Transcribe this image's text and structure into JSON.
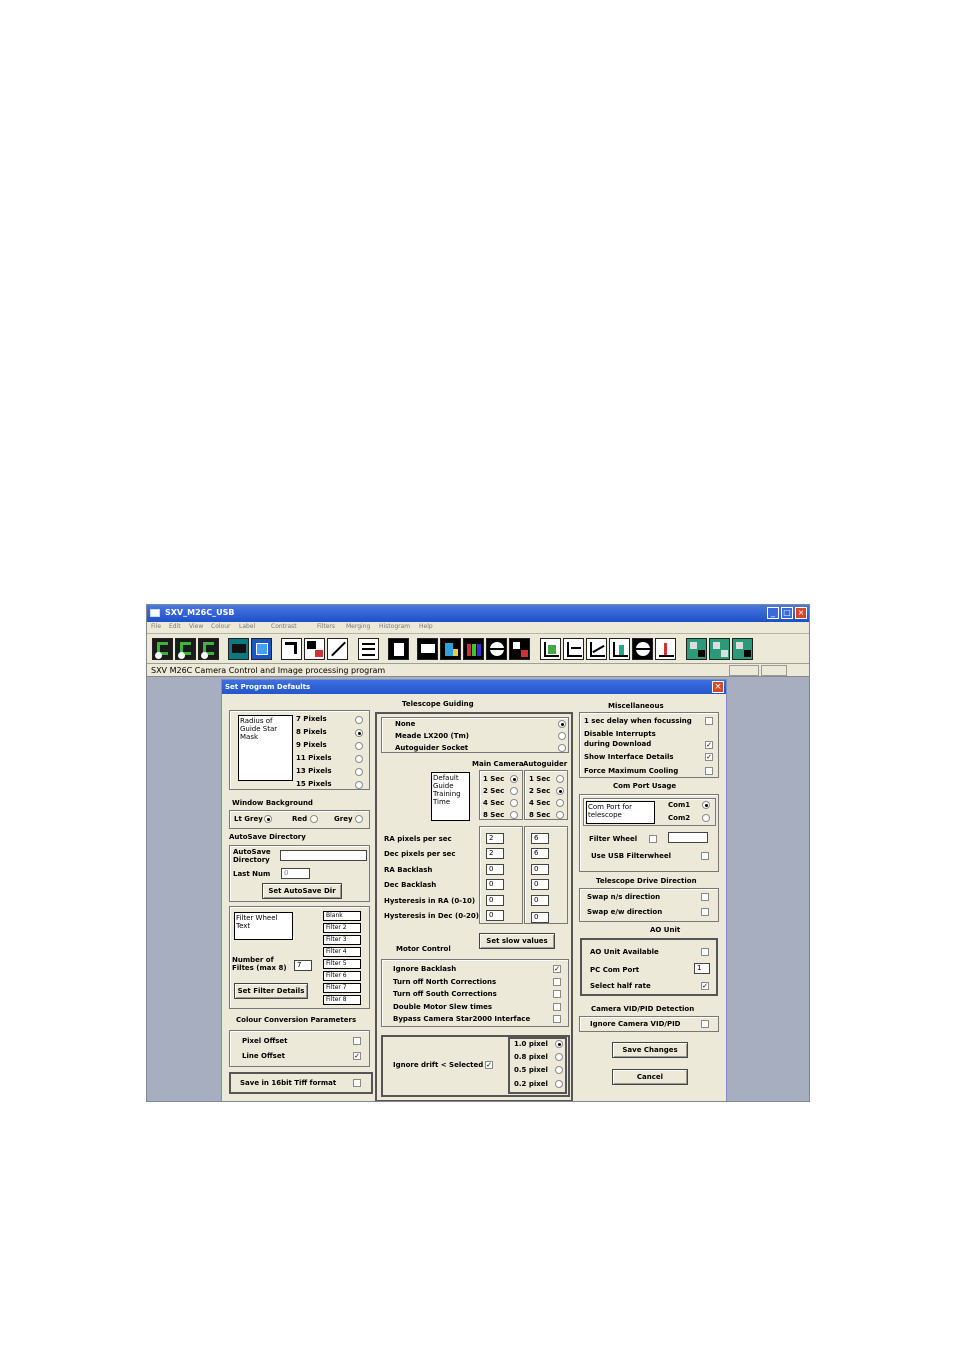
{
  "window": {
    "title": "SXV_M26C_USB",
    "min": "_",
    "max": "□",
    "close": "×"
  },
  "menu": [
    "File",
    "Edit",
    "View",
    "Colour",
    "Label",
    "Contrast",
    "Filters",
    "Merging",
    "Histogram",
    "Help"
  ],
  "status_text": "SXV M26C Camera Control and Image processing program",
  "dialog": {
    "title": "Set Program Defaults",
    "close": "×",
    "guide_mask": {
      "label": "Radius of Guide Star Mask",
      "options": [
        "7 Pixels",
        "8 Pixels",
        "9 Pixels",
        "11 Pixels",
        "13 Pixels",
        "15 Pixels"
      ],
      "selected": "8 Pixels"
    },
    "window_background": {
      "heading": "Window Background",
      "options": [
        "Lt Grey",
        "Red",
        "Grey"
      ],
      "selected": "Lt Grey"
    },
    "autosave": {
      "heading": "AutoSave Directory",
      "dir_label": "AutoSave Directory",
      "dir_value": "",
      "lastnum_label": "Last Num",
      "lastnum_value": "0",
      "button": "Set AutoSave Dir"
    },
    "filter_wheel_text": {
      "label": "Filter Wheel Text",
      "num_label": "Number of Filtes (max 8)",
      "num_value": "7",
      "filters": [
        "Blank",
        "Filter 2",
        "Filter 3",
        "Filter 4",
        "Filter 5",
        "Filter 6",
        "Filter 7",
        "Filter 8"
      ],
      "button": "Set Filter Details"
    },
    "colour_conversion": {
      "heading": "Colour Conversion Parameters",
      "pixel_offset": "Pixel Offset",
      "line_offset": "Line Offset",
      "pixel_checked": false,
      "line_checked": true
    },
    "save16": {
      "label": "Save in 16bit Tiff format",
      "checked": false
    },
    "telescope_guiding": {
      "heading": "Telescope Guiding",
      "options": [
        "None",
        "Meade LX200 (Tm)",
        "Autoguider Socket"
      ],
      "selected": "None",
      "main_camera": "Main Camera",
      "autoguider": "Autoguider",
      "training_label": "Default Guide Training Time",
      "secs": [
        "1 Sec",
        "2 Sec",
        "4 Sec",
        "8 Sec"
      ],
      "main_selected": "1 Sec",
      "auto_selected": "2 Sec",
      "params": [
        {
          "label": "RA pixels per sec",
          "main": "2",
          "auto": "6"
        },
        {
          "label": "Dec pixels per sec",
          "main": "2",
          "auto": "6"
        },
        {
          "label": "RA Backlash",
          "main": "0",
          "auto": "0"
        },
        {
          "label": "Dec Backlash",
          "main": "0",
          "auto": "0"
        },
        {
          "label": "Hysteresis in RA (0-10)",
          "main": "0",
          "auto": "0"
        },
        {
          "label": "Hysteresis in Dec (0-20)",
          "main": "0",
          "auto": "0"
        }
      ],
      "slow_button": "Set slow values"
    },
    "motor_control": {
      "heading": "Motor Control",
      "items": [
        {
          "label": "Ignore Backlash",
          "checked": true
        },
        {
          "label": "Turn off North Corrections",
          "checked": false
        },
        {
          "label": "Turn off South Corrections",
          "checked": false
        },
        {
          "label": "Double Motor Slew times",
          "checked": false
        },
        {
          "label": "Bypass Camera Star2000 Interface",
          "checked": false
        }
      ]
    },
    "drift": {
      "label": "Ignore drift < Selected",
      "checked": true,
      "options": [
        "1.0 pixel",
        "0.8 pixel",
        "0.5 pixel",
        "0.2 pixel"
      ],
      "selected": "1.0 pixel"
    },
    "misc": {
      "heading": "Miscellaneous",
      "items": [
        {
          "label": "1 sec delay when focussing",
          "checked": false
        },
        {
          "label": "Disable Interrupts during Download",
          "checked": true
        },
        {
          "label": "Show Interface Details",
          "checked": true
        },
        {
          "label": "Force Maximum Cooling",
          "checked": false
        }
      ]
    },
    "com_port": {
      "heading": "Com Port Usage",
      "label": "Com Port for telescope",
      "options": [
        "Com1",
        "Com2"
      ],
      "selected": "Com1",
      "filter_wheel": "Filter Wheel",
      "filter_wheel_value": "",
      "use_usb": "Use USB Filterwheel"
    },
    "drive_direction": {
      "heading": "Telescope Drive Direction",
      "ns": "Swap n/s direction",
      "ew": "Swap e/w direction"
    },
    "ao_unit": {
      "heading": "AO Unit",
      "available": "AO Unit Available",
      "com_port": "PC Com Port",
      "com_value": "1",
      "half_rate": "Select half rate",
      "half_checked": true
    },
    "vidpid": {
      "heading": "Camera VID/PID Detection",
      "label": "Ignore Camera VID/PID"
    },
    "save_button": "Save Changes",
    "cancel_button": "Cancel"
  }
}
